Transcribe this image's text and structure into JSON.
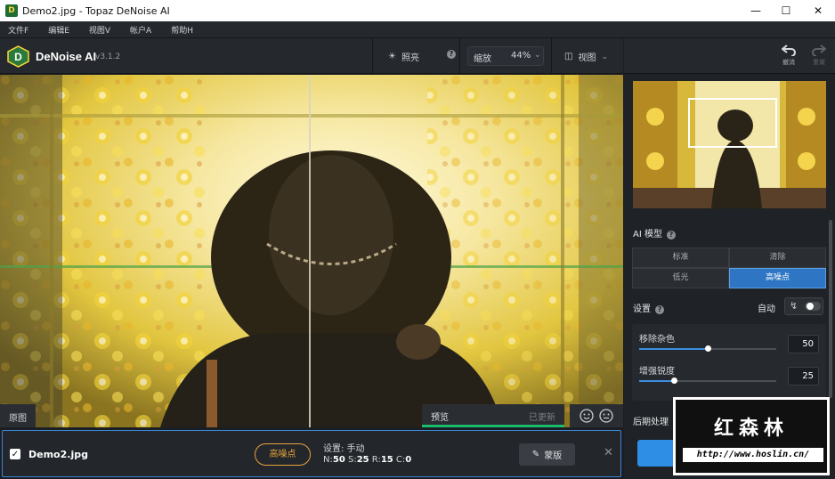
{
  "window": {
    "title": "Demo2.jpg - Topaz DeNoise AI",
    "minimize_icon": "minimize-icon",
    "maximize_icon": "maximize-icon",
    "close_icon": "close-icon"
  },
  "menu": [
    "文件F",
    "编辑E",
    "视图V",
    "帐户A",
    "帮助H"
  ],
  "toolbar": {
    "brand": "DeNoise AI",
    "version": "v3.1.2",
    "brightness_label": "照亮",
    "zoom_label": "缩放",
    "zoom_value": "44%",
    "view_label": "视图"
  },
  "history": {
    "undo_label": "撤消",
    "redo_label": "重做"
  },
  "viewer": {
    "original_label": "原图",
    "preview_label": "预览",
    "preview_status": "已更新"
  },
  "film": {
    "filename": "Demo2.jpg",
    "model_pill": "高噪点",
    "settings_text": "设置: 手动",
    "n_label": "N:",
    "n_value": "50",
    "s_label": "S:",
    "s_value": "25",
    "r_label": "R:",
    "r_value": "15",
    "c_label": "C:",
    "c_value": "0",
    "mask_label": "蒙版"
  },
  "panel": {
    "ai_model_title": "AI 模型",
    "models": [
      "标准",
      "清除",
      "低光",
      "高噪点"
    ],
    "active_model": "高噪点",
    "settings_title": "设置",
    "auto_label": "自动",
    "auto_enabled": false,
    "sliders": [
      {
        "label": "移除杂色",
        "value": "50",
        "level": 0.5
      },
      {
        "label": "增强锐度",
        "value": "25",
        "level": 0.25
      }
    ],
    "post_title": "后期处理"
  },
  "watermark": {
    "chinese": "红森林",
    "url": "http://www.hoslin.cn/"
  },
  "colors": {
    "accent": "#2e76c4",
    "pill": "#e8a23a",
    "preview_bar": "#1cbc6d"
  }
}
